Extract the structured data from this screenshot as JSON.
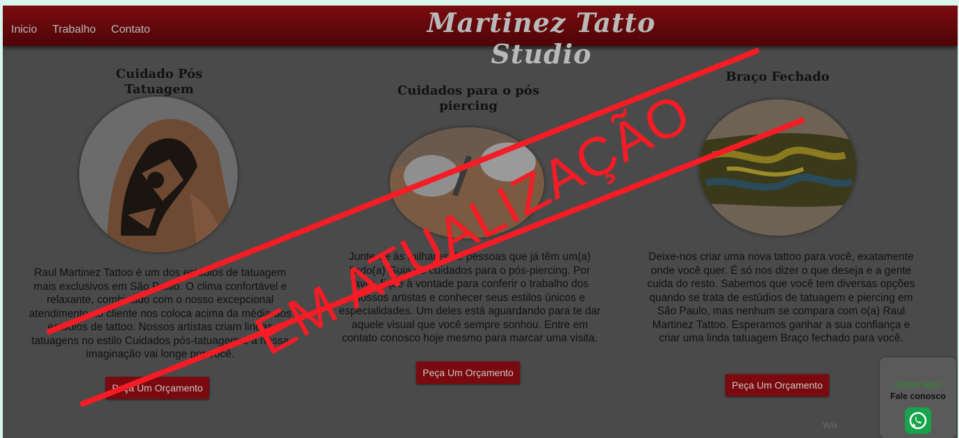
{
  "nav": {
    "items": [
      "Inicio",
      "Trabalho",
      "Contato"
    ]
  },
  "brand": {
    "title": "Martinez Tatto Studio"
  },
  "columns": [
    {
      "title": "Cuidado Pós Tatuagem",
      "text": "Raul Martinez Tattoo é um dos estúdios de tatuagem mais exclusivos em São Paulo. O clima confortável e relaxante, combinado com o nosso excepcional atendimento ao cliente nos coloca acima da média dos estúdios de tattoo. Nossos artistas criam lindas tatuagens no estilo Cuidados pós-tatuagem e a nossa imaginação vai longe por você.",
      "button": "Peça Um Orçamento"
    },
    {
      "title": "Cuidados para o pós piercing",
      "text": "Junte-se às milhares de pessoas que já têm um(a) lindo(a) Guia de cuidados para o pós-piercing. Por favor, fique à vontade para conferir o trabalho dos nossos artistas e conhecer seus estilos únicos e especialidades. Um deles está aguardando para te dar aquele visual que você sempre sonhou. Entre em contato conosco hoje mesmo para marcar uma visita.",
      "button": "Peça Um Orçamento"
    },
    {
      "title": "Braço Fechado",
      "text": "Deixe-nos criar uma nova tattoo para você, exatamente onde você quer. É só nos dizer o que deseja e a gente cuida do resto. Sabemos que você tem diversas opções quando se trata de estúdios de tatuagem e piercing em São Paulo, mas nenhum se compara com o(a) Raul Martinez Tattoo. Esperamos ganhar a sua confiança e criar uma linda tatuagem Braço fechado para você.",
      "button": "Peça Um Orçamento"
    }
  ],
  "stamp": {
    "text": "EM ATUALIZAÇÃO",
    "color": "#f51c25"
  },
  "whatsapp": {
    "line1": "clique aqui",
    "line2": "Fale conosco",
    "icon": "whatsapp-icon"
  },
  "footer": {
    "credit": "Wix"
  },
  "colors": {
    "header": "#7a0c0f",
    "button": "#7a0a0f",
    "background": "#4a4a4a"
  }
}
